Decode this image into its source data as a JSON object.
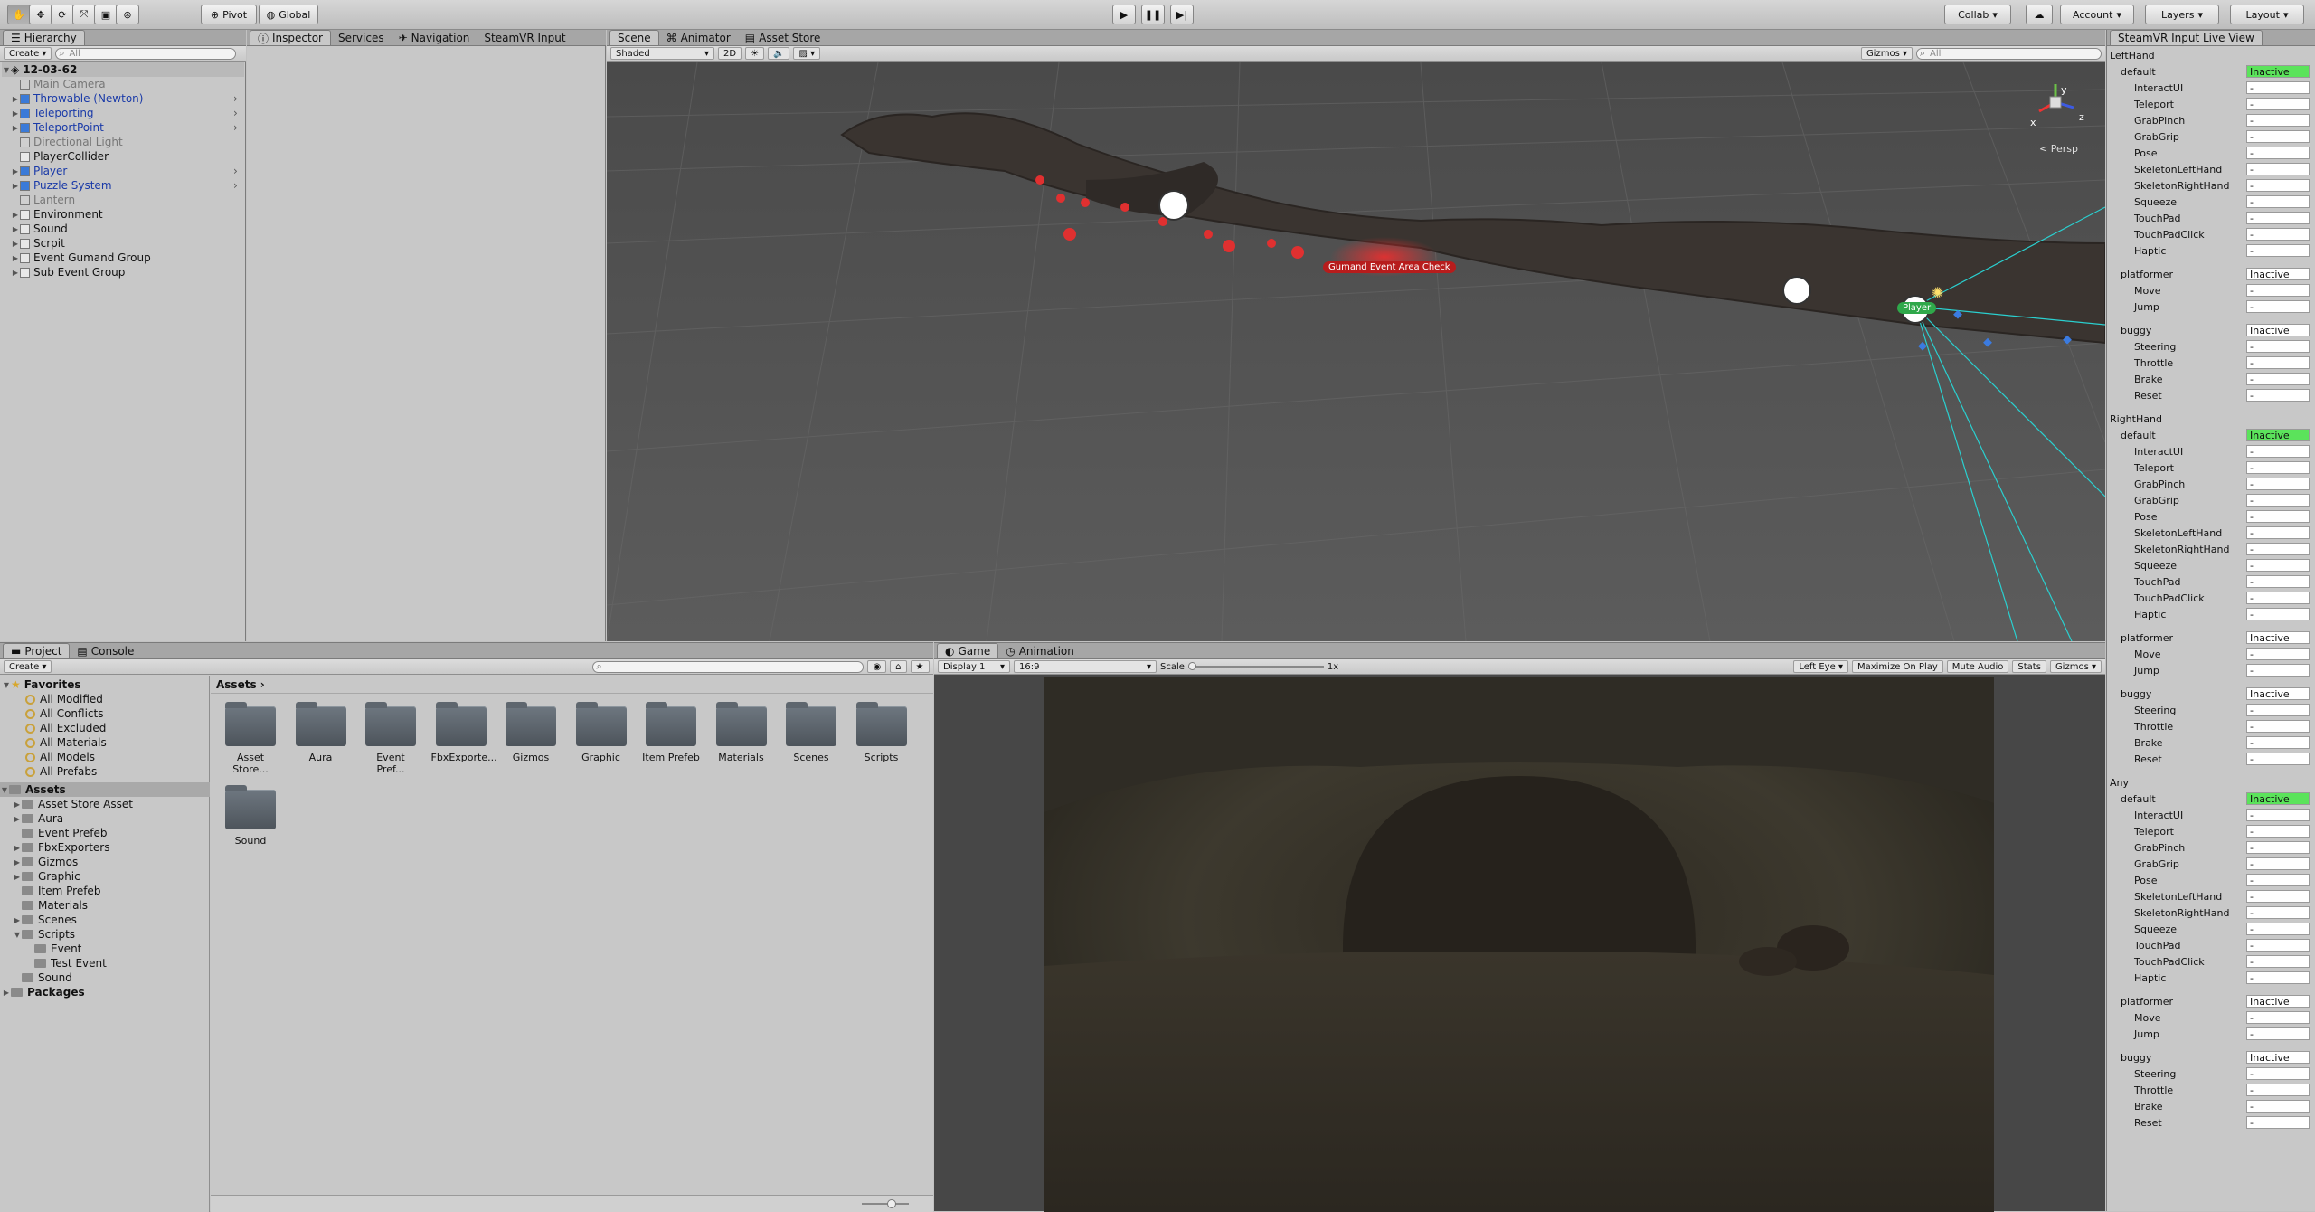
{
  "toolbar": {
    "tool_icons": [
      "hand-icon",
      "move-icon",
      "rotate-icon",
      "scale-icon",
      "rect-icon",
      "transform-icon"
    ],
    "pivot_label": "Pivot",
    "global_label": "Global",
    "collab_label": "Collab",
    "account_label": "Account",
    "layers_label": "Layers",
    "layout_label": "Layout"
  },
  "hierarchy": {
    "tab_label": "Hierarchy",
    "create_label": "Create",
    "search_placeholder": "All",
    "scene_name": "12-03-62",
    "items": [
      {
        "label": "Main Camera",
        "style": "gray"
      },
      {
        "label": "Throwable (Newton)",
        "style": "blue"
      },
      {
        "label": "Teleporting",
        "style": "blue"
      },
      {
        "label": "TeleportPoint",
        "style": "blue"
      },
      {
        "label": "Directional Light",
        "style": "gray"
      },
      {
        "label": "PlayerCollider",
        "style": "normal"
      },
      {
        "label": "Player",
        "style": "blue"
      },
      {
        "label": "Puzzle System",
        "style": "blue"
      },
      {
        "label": "Lantern",
        "style": "gray"
      },
      {
        "label": "Environment",
        "style": "normal"
      },
      {
        "label": "Sound",
        "style": "normal"
      },
      {
        "label": "Scrpit",
        "style": "normal"
      },
      {
        "label": "Event Gumand Group",
        "style": "normal"
      },
      {
        "label": "Sub Event Group",
        "style": "normal"
      }
    ]
  },
  "inspector_tabs": {
    "inspector": "Inspector",
    "services": "Services",
    "navigation": "Navigation",
    "steamvr_input": "SteamVR Input"
  },
  "scene": {
    "tabs": [
      "Scene",
      "Animator",
      "Asset Store"
    ],
    "shading": "Shaded",
    "mode_2d": "2D",
    "gizmos": "Gizmos",
    "search_placeholder": "All",
    "persp_label": "Persp",
    "axis_y": "y",
    "axis_x": "x",
    "axis_z": "z",
    "event_label": "Gumand Event Area Check",
    "player_label": "Player"
  },
  "project": {
    "tab_project": "Project",
    "tab_console": "Console",
    "create_label": "Create",
    "favorites_label": "Favorites",
    "favorites": [
      "All Modified",
      "All Conflicts",
      "All Excluded",
      "All Materials",
      "All Models",
      "All Prefabs"
    ],
    "assets_label": "Assets",
    "asset_tree": [
      "Asset Store Asset",
      "Aura",
      "Event Prefeb",
      "FbxExporters",
      "Gizmos",
      "Graphic",
      "Item Prefeb",
      "Materials",
      "Scenes",
      "Scripts"
    ],
    "scripts_children": [
      "Event",
      "Test Event"
    ],
    "sound_label": "Sound",
    "packages_label": "Packages",
    "breadcrumb": "Assets",
    "folders": [
      "Asset Store...",
      "Aura",
      "Event Pref...",
      "FbxExporte...",
      "Gizmos",
      "Graphic",
      "Item Prefeb",
      "Materials",
      "Scenes",
      "Scripts",
      "Sound"
    ]
  },
  "game": {
    "tab_game": "Game",
    "tab_animation": "Animation",
    "display": "Display 1",
    "aspect": "16:9",
    "scale_label": "Scale",
    "scale_value": "1x",
    "eye": "Left Eye",
    "maximize": "Maximize On Play",
    "mute": "Mute Audio",
    "stats": "Stats",
    "gizmos": "Gizmos"
  },
  "steamvr": {
    "title": "SteamVR Input Live View",
    "sections": [
      {
        "name": "LeftHand",
        "groups": [
          {
            "name": "default",
            "state": "Inactive",
            "active": true,
            "actions": [
              "InteractUI",
              "Teleport",
              "GrabPinch",
              "GrabGrip",
              "Pose",
              "SkeletonLeftHand",
              "SkeletonRightHand",
              "Squeeze",
              "TouchPad",
              "TouchPadClick",
              "Haptic"
            ]
          },
          {
            "name": "platformer",
            "state": "Inactive",
            "active": false,
            "actions": [
              "Move",
              "Jump"
            ]
          },
          {
            "name": "buggy",
            "state": "Inactive",
            "active": false,
            "actions": [
              "Steering",
              "Throttle",
              "Brake",
              "Reset"
            ]
          }
        ]
      },
      {
        "name": "RightHand",
        "groups": [
          {
            "name": "default",
            "state": "Inactive",
            "active": true,
            "actions": [
              "InteractUI",
              "Teleport",
              "GrabPinch",
              "GrabGrip",
              "Pose",
              "SkeletonLeftHand",
              "SkeletonRightHand",
              "Squeeze",
              "TouchPad",
              "TouchPadClick",
              "Haptic"
            ]
          },
          {
            "name": "platformer",
            "state": "Inactive",
            "active": false,
            "actions": [
              "Move",
              "Jump"
            ]
          },
          {
            "name": "buggy",
            "state": "Inactive",
            "active": false,
            "actions": [
              "Steering",
              "Throttle",
              "Brake",
              "Reset"
            ]
          }
        ]
      },
      {
        "name": "Any",
        "groups": [
          {
            "name": "default",
            "state": "Inactive",
            "active": true,
            "actions": [
              "InteractUI",
              "Teleport",
              "GrabPinch",
              "GrabGrip",
              "Pose",
              "SkeletonLeftHand",
              "SkeletonRightHand",
              "Squeeze",
              "TouchPad",
              "TouchPadClick",
              "Haptic"
            ]
          },
          {
            "name": "platformer",
            "state": "Inactive",
            "active": false,
            "actions": [
              "Move",
              "Jump"
            ]
          },
          {
            "name": "buggy",
            "state": "Inactive",
            "active": false,
            "actions": [
              "Steering",
              "Throttle",
              "Brake",
              "Reset"
            ]
          }
        ]
      }
    ],
    "value_placeholder": "-",
    "colors": {
      "active": "#5be35b"
    }
  }
}
